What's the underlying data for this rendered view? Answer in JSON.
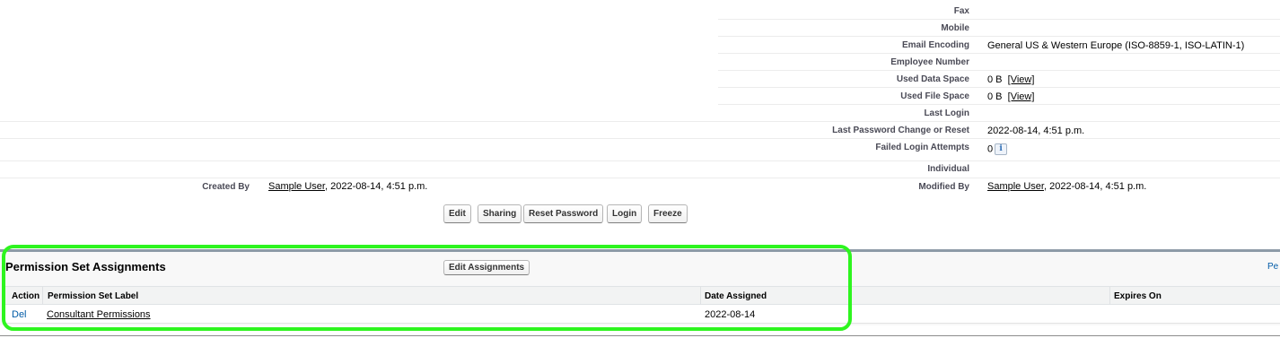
{
  "details": [
    {
      "label": "Fax",
      "value": ""
    },
    {
      "label": "Mobile",
      "value": ""
    },
    {
      "label": "Email Encoding",
      "value": "General US & Western Europe (ISO-8859-1, ISO-LATIN-1)"
    },
    {
      "label": "Employee Number",
      "value": ""
    },
    {
      "label": "Used Data Space",
      "value": "0 B",
      "link": "[View]"
    },
    {
      "label": "Used File Space",
      "value": "0 B",
      "link": "[View]"
    },
    {
      "label": "Last Login",
      "value": ""
    },
    {
      "label": "Last Password Change or Reset",
      "value": "2022-08-14, 4:51 p.m."
    },
    {
      "label": "Failed Login Attempts",
      "value": "0",
      "icon": "info-icon"
    },
    {
      "label": "Individual",
      "value": ""
    }
  ],
  "created_by": {
    "label": "Created By",
    "user": "Sample User",
    "date": ", 2022-08-14, 4:51 p.m."
  },
  "modified_by": {
    "label": "Modified By",
    "user": "Sample User",
    "date": ", 2022-08-14, 4:51 p.m."
  },
  "buttons": [
    "Edit",
    "Sharing",
    "Reset Password",
    "Login",
    "Freeze"
  ],
  "info_icon_glyph": "i",
  "related_list": {
    "title": "Permission Set Assignments",
    "button": "Edit Assignments",
    "help_link": "Pe",
    "columns": [
      "Action",
      "Permission Set Label",
      "Date Assigned",
      "Expires On"
    ],
    "rows": [
      {
        "action": "Del",
        "label": "Consultant Permissions",
        "date_assigned": "2022-08-14",
        "expires_on": ""
      }
    ]
  },
  "colors": {
    "highlight": "#2ef51f",
    "link": "#015ba7",
    "label": "#4a4a56"
  }
}
